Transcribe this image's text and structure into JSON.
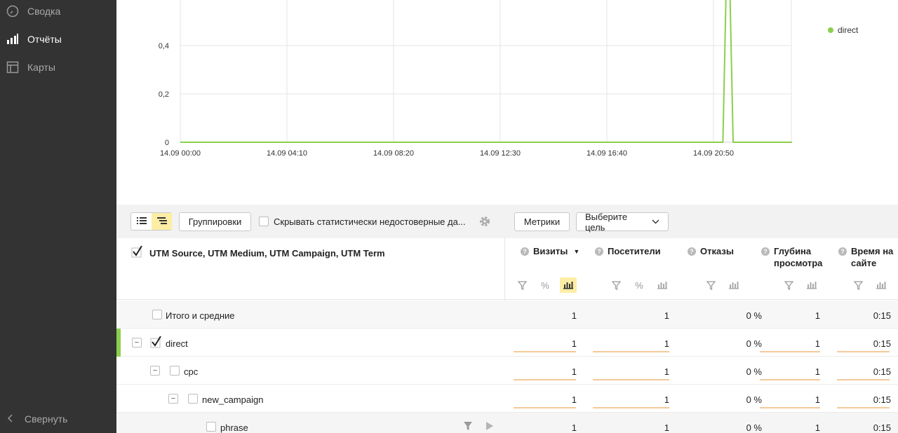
{
  "sidebar": {
    "items": [
      {
        "label": "Сводка",
        "icon": "gauge-icon",
        "active": false
      },
      {
        "label": "Отчёты",
        "icon": "bar-chart-icon",
        "active": true
      },
      {
        "label": "Карты",
        "icon": "map-layout-icon",
        "active": false
      }
    ],
    "collapse_label": "Свернуть"
  },
  "chart_data": {
    "type": "line",
    "x_ticks": [
      "14.09 00:00",
      "14.09 04:10",
      "14.09 08:20",
      "14.09 12:30",
      "14.09 16:40",
      "14.09 20:50"
    ],
    "y_ticks": [
      "0",
      "0,2",
      "0,4"
    ],
    "ylim": [
      0,
      0.6
    ],
    "grid": true,
    "legend_position": "top-right",
    "series": [
      {
        "name": "direct",
        "color": "#8bcf4d",
        "points": [
          {
            "hours": 0,
            "value": 0
          },
          {
            "hours": 21.2,
            "value": 0
          },
          {
            "hours": 21.4,
            "value": 1
          },
          {
            "hours": 21.6,
            "value": 0
          },
          {
            "hours": 23.9,
            "value": 0
          }
        ]
      }
    ]
  },
  "toolbar": {
    "groupings_label": "Группировки",
    "hide_unreliable_label": "Скрывать статистически недостоверные да...",
    "metrics_label": "Метрики",
    "goal_label": "Выберите цель"
  },
  "table": {
    "dimension_title": "UTM Source, UTM Medium, UTM Campaign, UTM Term",
    "columns": [
      {
        "label": "Визиты",
        "sorted": "desc"
      },
      {
        "label": "Посетители"
      },
      {
        "label": "Отказы"
      },
      {
        "label": "Глубина просмотра"
      },
      {
        "label": "Время на сайте"
      }
    ],
    "sort_arrow": "▼",
    "percent_symbol": "%",
    "rows": [
      {
        "label": "Итого и средние",
        "visits": "1",
        "visitors": "1",
        "bounces": "0 %",
        "depth": "1",
        "time": "0:15"
      },
      {
        "label": "direct",
        "visits": "1",
        "visitors": "1",
        "bounces": "0 %",
        "depth": "1",
        "time": "0:15"
      },
      {
        "label": "cpc",
        "visits": "1",
        "visitors": "1",
        "bounces": "0 %",
        "depth": "1",
        "time": "0:15"
      },
      {
        "label": "new_campaign",
        "visits": "1",
        "visitors": "1",
        "bounces": "0 %",
        "depth": "1",
        "time": "0:15"
      },
      {
        "label": "phrase",
        "visits": "1",
        "visitors": "1",
        "bounces": "0 %",
        "depth": "1",
        "time": "0:15"
      }
    ]
  },
  "colors": {
    "sidebar_bg": "#333333",
    "series": "#8bcf4d",
    "bar": "#f4c99a",
    "active_toggle": "#fdeea5"
  }
}
